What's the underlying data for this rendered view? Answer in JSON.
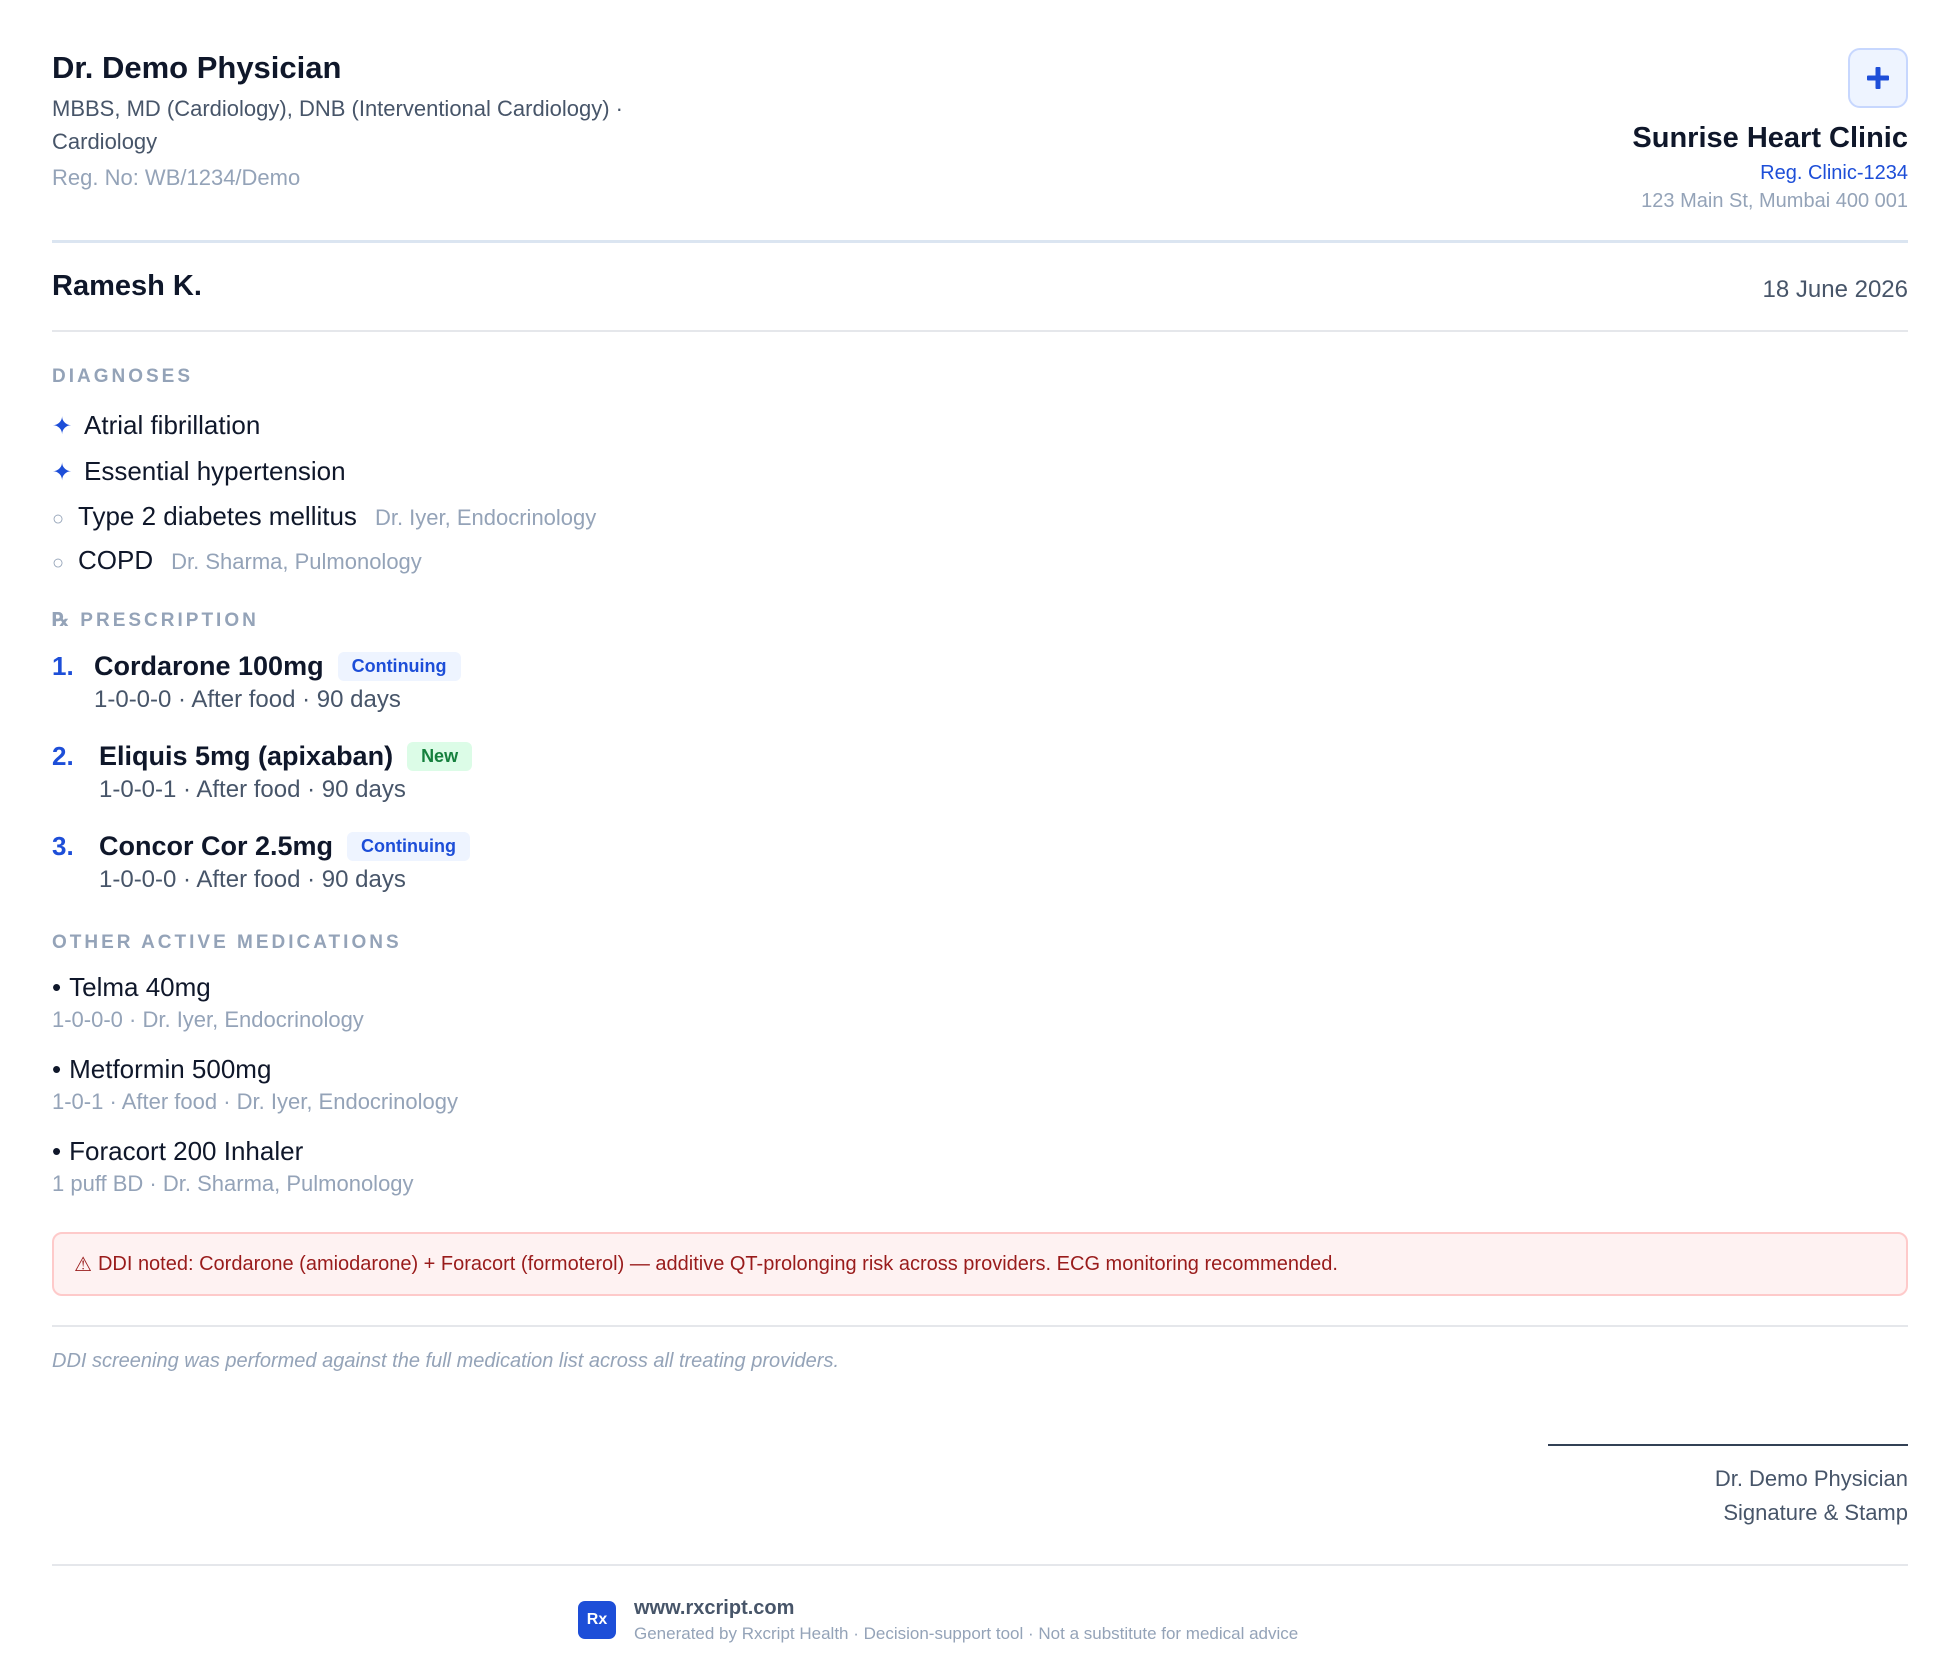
{
  "doctor": {
    "name": "Dr. Demo Physician",
    "qualifications": "MBBS, MD (Cardiology), DNB (Interventional Cardiology) · Cardiology",
    "reg": "Reg. No: WB/1234/Demo"
  },
  "clinic": {
    "logo_icon": "plus-icon",
    "name": "Sunrise Heart Clinic",
    "reg": "Reg. Clinic-1234",
    "address": "123 Main St, Mumbai 400 001"
  },
  "patient": {
    "name": "Ramesh K.",
    "date": "18 June 2026"
  },
  "diagnoses": {
    "title": "DIAGNOSES",
    "items": [
      {
        "marker": "✦",
        "text": "Atrial fibrillation",
        "by": ""
      },
      {
        "marker": "✦",
        "text": "Essential hypertension",
        "by": ""
      },
      {
        "marker": "○",
        "text": "Type 2 diabetes mellitus",
        "by": "Dr. Iyer, Endocrinology"
      },
      {
        "marker": "○",
        "text": "COPD",
        "by": "Dr. Sharma, Pulmonology"
      }
    ]
  },
  "prescription": {
    "title": "℞ PRESCRIPTION",
    "items": [
      {
        "num": "1.",
        "drug": "Cordarone 100mg",
        "badge": "Continuing",
        "details": "1-0-0-0 · After food · 90 days"
      },
      {
        "num": "2.",
        "drug": "Eliquis 5mg (apixaban)",
        "badge": "New",
        "details": "1-0-0-1 · After food · 90 days"
      },
      {
        "num": "3.",
        "drug": "Concor Cor 2.5mg",
        "badge": "Continuing",
        "details": "1-0-0-0 · After food · 90 days"
      }
    ]
  },
  "other_meds": {
    "title": "OTHER ACTIVE MEDICATIONS",
    "bullet": "•",
    "items": [
      {
        "name": "Telma 40mg",
        "meta": "1-0-0-0 · Dr. Iyer, Endocrinology"
      },
      {
        "name": "Metformin 500mg",
        "meta": "1-0-1 · After food · Dr. Iyer, Endocrinology"
      },
      {
        "name": "Foracort 200 Inhaler",
        "meta": "1 puff BD · Dr. Sharma, Pulmonology"
      }
    ]
  },
  "alert": {
    "icon": "⚠",
    "text": "DDI noted: Cordarone (amiodarone) + Foracort (formoterol) — additive QT-prolonging risk across providers. ECG monitoring recommended."
  },
  "note": "DDI screening was performed against the full medication list across all treating providers.",
  "signature": {
    "name": "Dr. Demo Physician",
    "label": "Signature & Stamp"
  },
  "footer": {
    "logo_text": "Rx",
    "site": "www.rxcript.com",
    "tagline": "Generated by Rxcript Health · Decision-support tool · Not a substitute for medical advice"
  },
  "colors": {
    "accent": "#1d4ed8",
    "new_badge": "#15803d",
    "alert_text": "#991b1b",
    "alert_bg": "#fef2f2"
  }
}
